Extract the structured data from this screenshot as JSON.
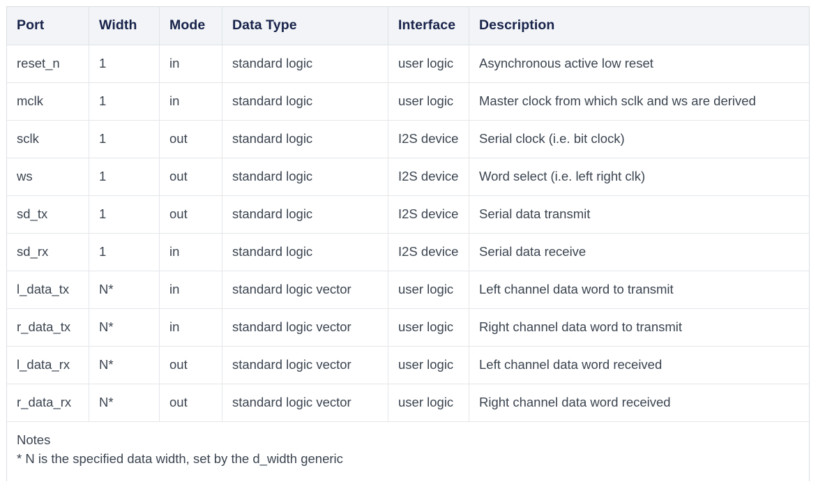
{
  "table": {
    "columns": [
      {
        "key": "port",
        "label": "Port"
      },
      {
        "key": "width",
        "label": "Width"
      },
      {
        "key": "mode",
        "label": "Mode"
      },
      {
        "key": "data_type",
        "label": "Data Type"
      },
      {
        "key": "interface",
        "label": "Interface"
      },
      {
        "key": "description",
        "label": "Description"
      }
    ],
    "rows": [
      {
        "port": "reset_n",
        "width": "1",
        "mode": "in",
        "data_type": "standard logic",
        "interface": "user logic",
        "description": "Asynchronous active low reset"
      },
      {
        "port": "mclk",
        "width": "1",
        "mode": "in",
        "data_type": "standard logic",
        "interface": "user logic",
        "description": "Master clock from which sclk and ws are derived"
      },
      {
        "port": "sclk",
        "width": "1",
        "mode": "out",
        "data_type": "standard logic",
        "interface": "I2S device",
        "description": "Serial clock (i.e. bit clock)"
      },
      {
        "port": "ws",
        "width": "1",
        "mode": "out",
        "data_type": "standard logic",
        "interface": "I2S device",
        "description": "Word select (i.e. left right clk)"
      },
      {
        "port": "sd_tx",
        "width": "1",
        "mode": "out",
        "data_type": "standard logic",
        "interface": "I2S device",
        "description": "Serial data transmit"
      },
      {
        "port": "sd_rx",
        "width": "1",
        "mode": "in",
        "data_type": "standard logic",
        "interface": "I2S device",
        "description": "Serial data receive"
      },
      {
        "port": "l_data_tx",
        "width": "N*",
        "mode": "in",
        "data_type": "standard logic vector",
        "interface": "user logic",
        "description": "Left channel data word to transmit"
      },
      {
        "port": "r_data_tx",
        "width": "N*",
        "mode": "in",
        "data_type": "standard logic vector",
        "interface": "user logic",
        "description": "Right channel data word to transmit"
      },
      {
        "port": "l_data_rx",
        "width": "N*",
        "mode": "out",
        "data_type": "standard logic vector",
        "interface": "user logic",
        "description": "Left channel data word received"
      },
      {
        "port": "r_data_rx",
        "width": "N*",
        "mode": "out",
        "data_type": "standard logic vector",
        "interface": "user logic",
        "description": "Right channel data word received"
      }
    ],
    "notes": {
      "title": "Notes",
      "text": "* N is the specified data width, set by the d_width generic"
    }
  },
  "colors": {
    "header_background": "#f2f4f7",
    "header_text": "#17224a",
    "body_text": "#3b4450",
    "border": "#e3e6ea",
    "page_background": "#ffffff"
  }
}
